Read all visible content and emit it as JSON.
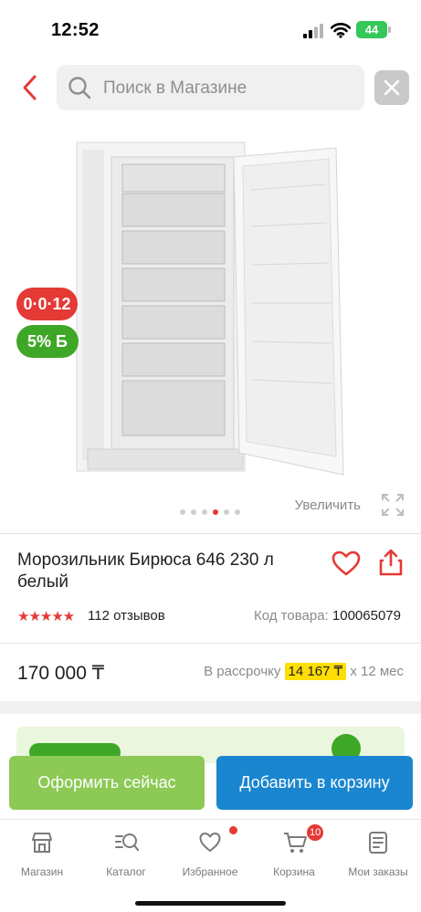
{
  "status_bar": {
    "time": "12:52",
    "battery": "44"
  },
  "search": {
    "placeholder": "Поиск в Магазине"
  },
  "gallery": {
    "badge_discount": "0·0·12",
    "badge_bonus": "5% Б",
    "zoom_label": "Увеличить",
    "active_slide": 3,
    "slide_count": 5
  },
  "product": {
    "title": "Морозильник Бирюса 646 230 л белый",
    "stars": "★★★★★",
    "reviews": "112 отзывов",
    "code_label": "Код товара:",
    "code_value": "100065079",
    "price": "170 000 ₸",
    "installment_prefix": "В рассрочку",
    "installment_amount": "14 167 ₸",
    "installment_suffix": "х 12 мес"
  },
  "actions": {
    "checkout_label": "Оформить сейчас",
    "cart_label": "Добавить в корзину"
  },
  "nav": {
    "items": [
      {
        "label": "Магазин",
        "icon": "shop-icon"
      },
      {
        "label": "Каталог",
        "icon": "catalog-search-icon"
      },
      {
        "label": "Избранное",
        "icon": "heart-icon"
      },
      {
        "label": "Корзина",
        "icon": "cart-icon",
        "count": "10"
      },
      {
        "label": "Мои заказы",
        "icon": "orders-icon"
      }
    ]
  },
  "colors": {
    "accent_red": "#e53935",
    "bonus_green": "#3fa728",
    "checkout_green": "#8cc955",
    "cart_blue": "#1a86d0",
    "installment_yellow": "#fede05"
  }
}
